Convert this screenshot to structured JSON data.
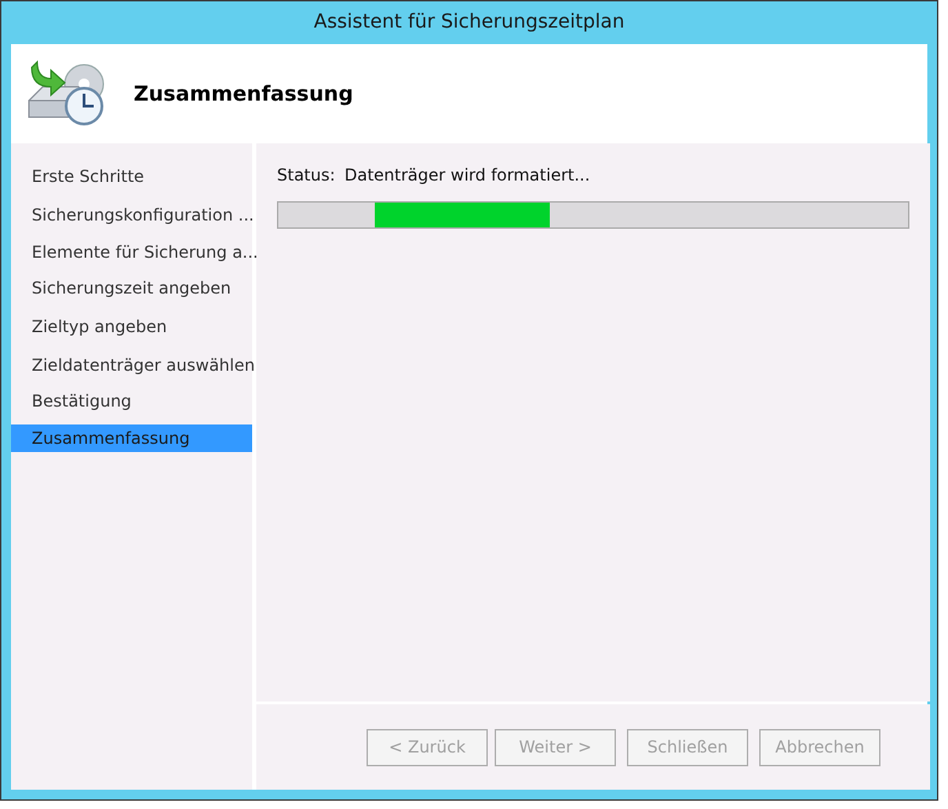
{
  "window": {
    "title": "Assistent für Sicherungszeitplan"
  },
  "header": {
    "title": "Zusammenfassung"
  },
  "steps": [
    {
      "label": "Erste Schritte",
      "selected": false
    },
    {
      "label": "Sicherungskonfiguration ...",
      "selected": false
    },
    {
      "label": "Elemente für Sicherung a...",
      "selected": false
    },
    {
      "label": "Sicherungszeit angeben",
      "selected": false
    },
    {
      "label": "Zieltyp angeben",
      "selected": false
    },
    {
      "label": "Zieldatenträger auswählen",
      "selected": false
    },
    {
      "label": "Bestätigung",
      "selected": false
    },
    {
      "label": "Zusammenfassung",
      "selected": true
    }
  ],
  "status": {
    "label": "Status:",
    "value": "Datenträger wird formatiert..."
  },
  "progress": {
    "indeterminate": true
  },
  "buttons": [
    {
      "label": "< Zurück",
      "disabled": true
    },
    {
      "label": "Weiter >",
      "disabled": true
    },
    {
      "label": "Schließen",
      "disabled": true
    },
    {
      "label": "Abbrechen",
      "disabled": true
    }
  ]
}
